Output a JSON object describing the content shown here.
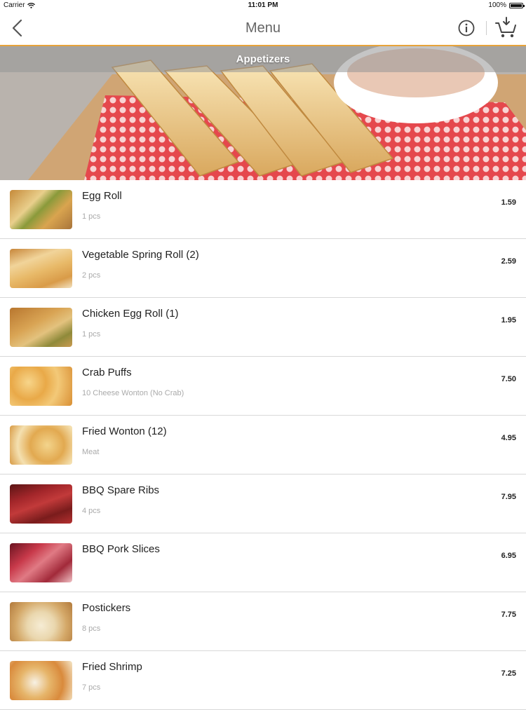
{
  "status_bar": {
    "carrier": "Carrier",
    "time": "11:01 PM",
    "battery": "100%"
  },
  "nav": {
    "title": "Menu"
  },
  "banner": {
    "caption": "Appetizers"
  },
  "items": [
    {
      "name": "Egg Roll",
      "desc": "1 pcs",
      "price": "1.59"
    },
    {
      "name": "Vegetable Spring Roll (2)",
      "desc": "2 pcs",
      "price": "2.59"
    },
    {
      "name": "Chicken Egg Roll (1)",
      "desc": "1 pcs",
      "price": "1.95"
    },
    {
      "name": "Crab Puffs",
      "desc": "10 Cheese Wonton (No Crab)",
      "price": "7.50"
    },
    {
      "name": "Fried Wonton (12)",
      "desc": "Meat",
      "price": "4.95"
    },
    {
      "name": "BBQ Spare Ribs",
      "desc": "4 pcs",
      "price": "7.95"
    },
    {
      "name": "BBQ Pork Slices",
      "desc": "",
      "price": "6.95"
    },
    {
      "name": "Postickers",
      "desc": "8 pcs",
      "price": "7.75"
    },
    {
      "name": "Fried Shrimp",
      "desc": "7 pcs",
      "price": "7.25"
    }
  ],
  "colors": {
    "accent": "#e7a33a",
    "divider": "#d8d8d8"
  }
}
